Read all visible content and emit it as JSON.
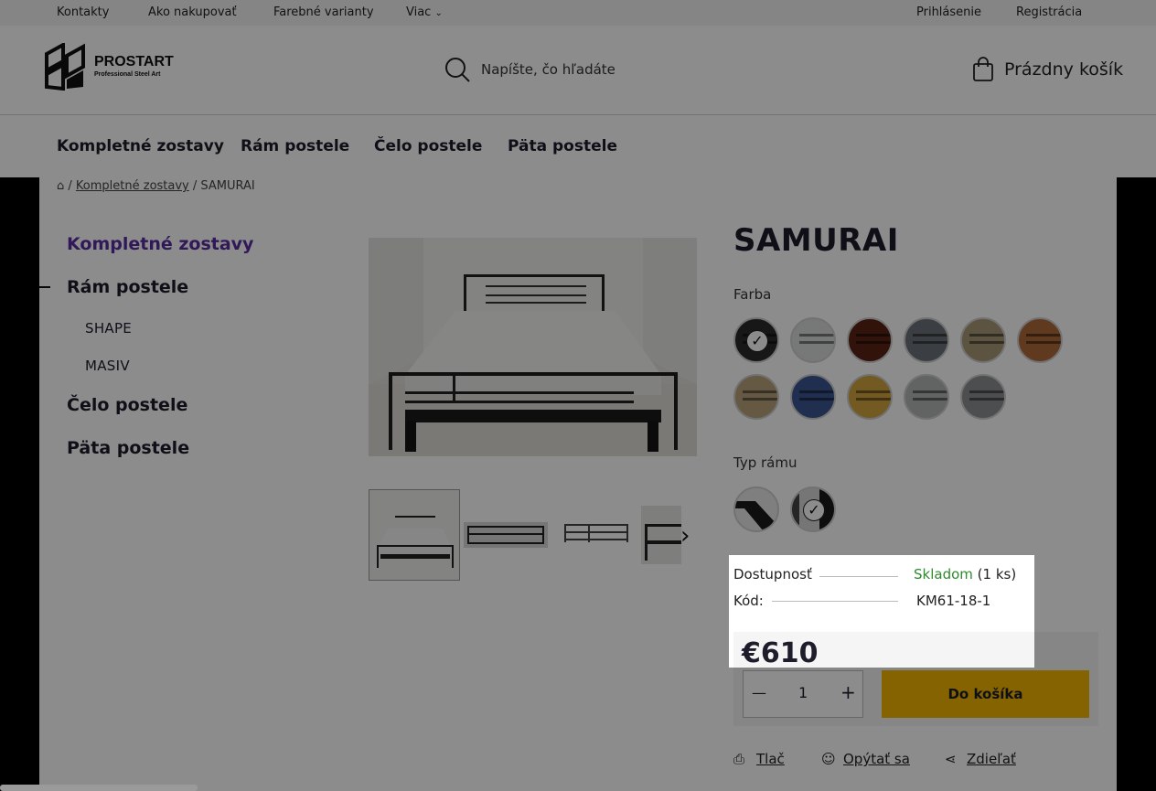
{
  "topbar": {
    "links": [
      "Kontakty",
      "Ako nakupovať",
      "Farebné varianty",
      "Viac"
    ],
    "login": "Prihlásenie",
    "register": "Registrácia"
  },
  "header": {
    "logo_text": "PROSTART",
    "logo_sub": "Professional Steel Art",
    "search_placeholder": "Napíšte, čo hľadáte",
    "cart_label": "Prázdny košík"
  },
  "catnav": [
    "Kompletné zostavy",
    "Rám postele",
    "Čelo postele",
    "Päta postele"
  ],
  "breadcrumb": {
    "parent": "Kompletné zostavy",
    "current": "SAMURAI"
  },
  "sidemenu": {
    "active": "Kompletné zostavy",
    "frame": "Rám postele",
    "sub1": "SHAPE",
    "sub2": "MASIV",
    "head": "Čelo postele",
    "foot": "Päta postele"
  },
  "product": {
    "title": "SAMURAI",
    "color_label": "Farba",
    "frame_label": "Typ rámu",
    "availability_label": "Dostupnosť",
    "availability_value": "Skladom",
    "availability_qty": "(1 ks)",
    "code_label": "Kód:",
    "code_value": "KM61-18-1",
    "price": "€610",
    "qty": "1",
    "buy_label": "Do košíka",
    "colors": [
      "#2a2a2a",
      "#d9dcdd",
      "#5a2417",
      "#6c737a",
      "#a89877",
      "#b06a3a",
      "#b9a27c",
      "#3b5490",
      "#d2a43e",
      "#b3b6b7",
      "#8d8f91"
    ],
    "status_color": "#2e8b2e"
  },
  "actions": {
    "print": "Tlač",
    "ask": "Opýtať sa",
    "share": "Zdieľať"
  }
}
